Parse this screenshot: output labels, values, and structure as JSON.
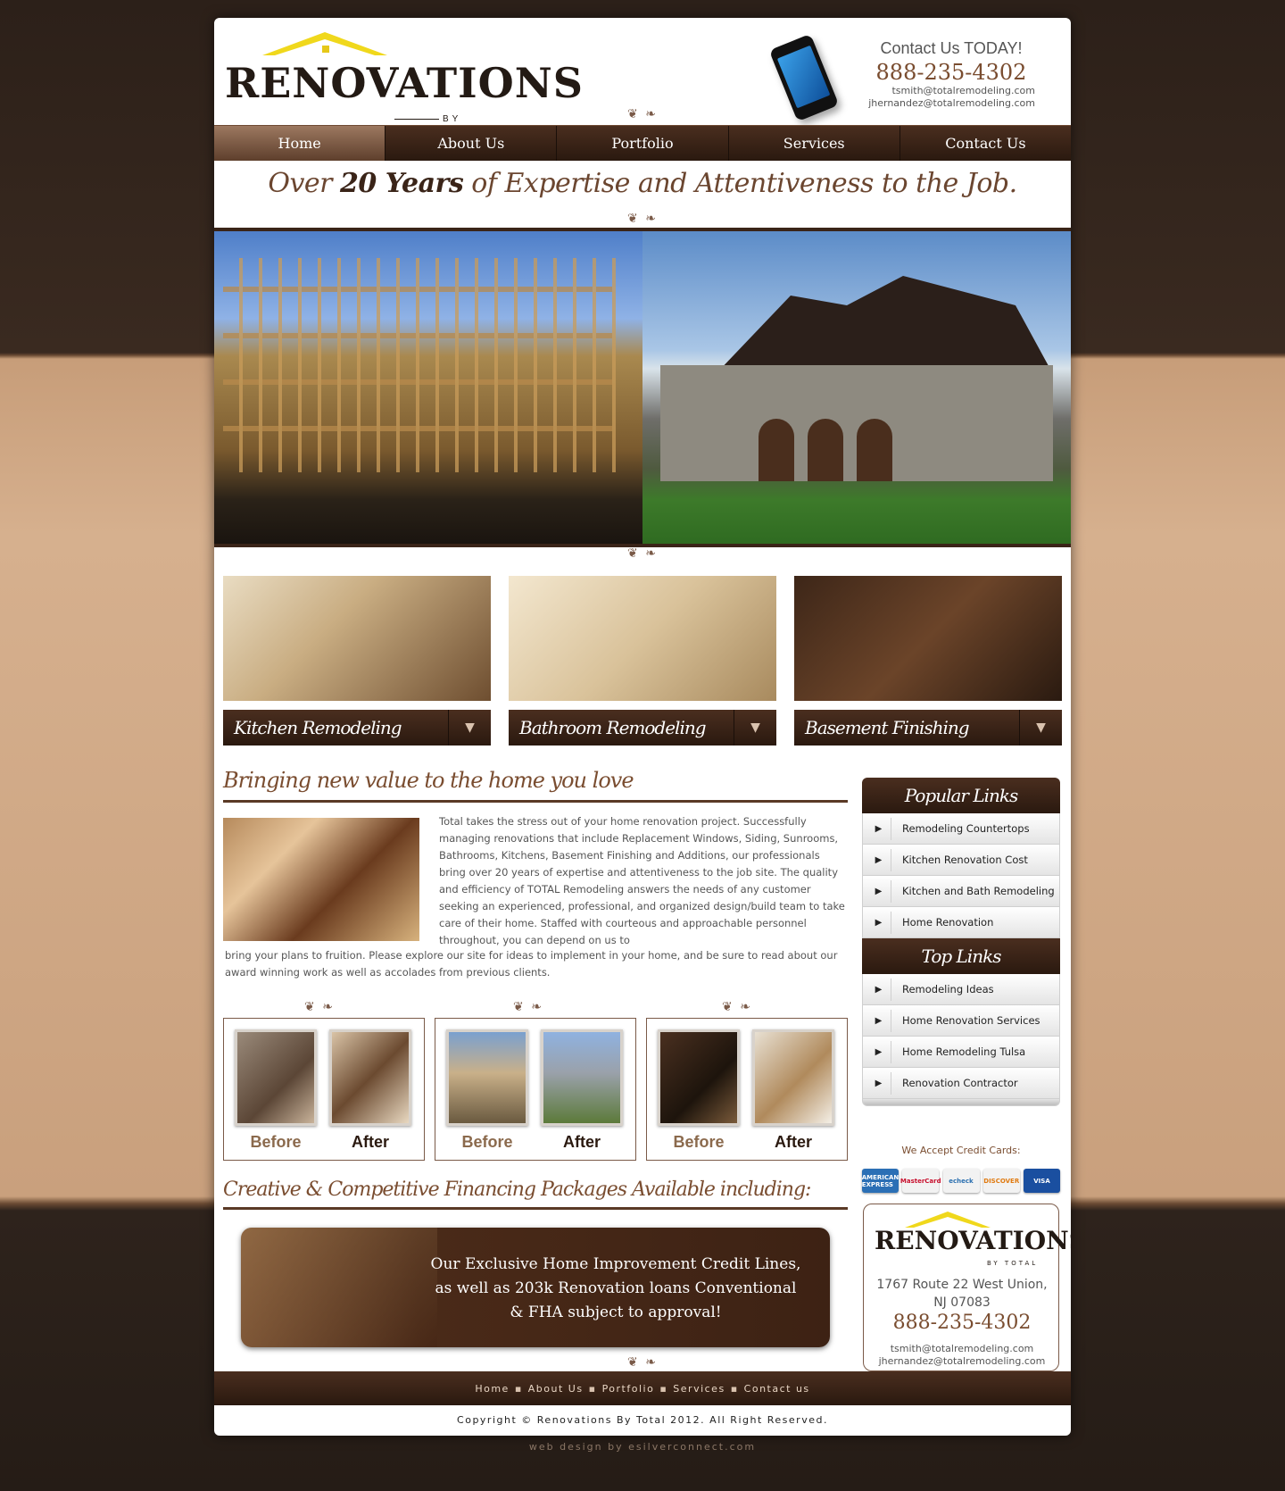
{
  "header": {
    "logo_main": "RENOVATIONS",
    "logo_sub": "BY TOTAL",
    "contact_heading": "Contact Us TODAY!",
    "phone": "888-235-4302",
    "emails": [
      "tsmith@totalremodeling.com",
      "jhernandez@totalremodeling.com"
    ]
  },
  "nav": {
    "items": [
      {
        "label": "Home",
        "active": true
      },
      {
        "label": "About Us"
      },
      {
        "label": "Portfolio"
      },
      {
        "label": "Services"
      },
      {
        "label": "Contact Us"
      }
    ]
  },
  "tagline": {
    "part1": "Over ",
    "bold": "20 Years",
    "part2": " of Expertise and Attentiveness to the Job."
  },
  "features": [
    {
      "label": "Kitchen Remodeling"
    },
    {
      "label": "Bathroom Remodeling"
    },
    {
      "label": "Basement Finishing"
    }
  ],
  "main": {
    "title": "Bringing new value to the home you love",
    "body": "Total takes the stress out of your home renovation project. Successfully managing renovations that include Replacement Windows, Siding, Sunrooms, Bathrooms, Kitchens, Basement Finishing and Additions, our professionals bring over 20 years of expertise and attentiveness to the job site. The quality and efficiency of TOTAL Remodeling answers the needs of any customer seeking an experienced, professional, and organized design/build team to take care of their home. Staffed with courteous and approachable personnel throughout, you can depend on us to",
    "body_cont": "bring your plans to fruition. Please explore our site for ideas to implement in your home, and be sure to read about our award winning work as well as accolades from previous clients.",
    "before_label": "Before",
    "after_label": "After",
    "financing_title": "Creative & Competitive Financing Packages Available including:",
    "financing_text": "Our Exclusive Home Improvement Credit Lines, as well as 203k Renovation loans Conventional & FHA subject to approval!"
  },
  "sidebar": {
    "popular_title": "Popular Links",
    "popular": [
      "Remodeling Countertops",
      "Kitchen Renovation Cost",
      "Kitchen and Bath Remodeling",
      "Home Renovation"
    ],
    "top_title": "Top Links",
    "top": [
      "Remodeling Ideas",
      "Home Renovation Services",
      "Home Remodeling Tulsa",
      "Renovation Contractor"
    ],
    "credit_title": "We Accept Credit Cards:",
    "cards": [
      "AMERICAN EXPRESS",
      "MasterCard",
      "echeck",
      "DISCOVER",
      "VISA"
    ],
    "address_line1": "1767 Route 22 West Union,",
    "address_line2": "NJ 07083",
    "phone": "888-235-4302",
    "emails": [
      "tsmith@totalremodeling.com",
      "jhernandez@totalremodeling.com"
    ]
  },
  "footer": {
    "links": [
      "Home",
      "About Us",
      "Portfolio",
      "Services",
      "Contact us"
    ],
    "copyright": "Copyright © Renovations By Total 2012. All Right Reserved.",
    "credit": "web design by esilverconnect.com"
  },
  "colors": {
    "brown_dark": "#2a190f",
    "brown_accent": "#7a4d30",
    "logo_yellow": "#f0d81c"
  }
}
